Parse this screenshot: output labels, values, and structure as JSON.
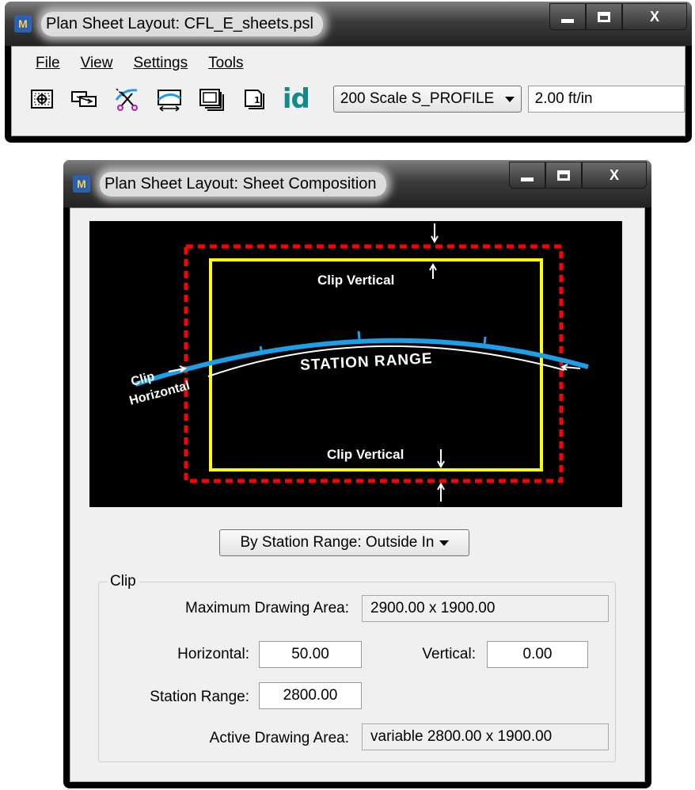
{
  "main_window": {
    "title": "Plan Sheet Layout: CFL_E_sheets.psl",
    "app_icon_glyph": "M",
    "menu": [
      {
        "label": "File"
      },
      {
        "label": "View"
      },
      {
        "label": "Settings"
      },
      {
        "label": "Tools"
      }
    ],
    "toolbar": {
      "tools": [
        {
          "icon": "place-sheet-icon"
        },
        {
          "icon": "move-sheet-icon"
        },
        {
          "icon": "clip-sheet-icon"
        },
        {
          "icon": "sheet-along-alignment-icon"
        },
        {
          "icon": "sheet-composition-icon"
        },
        {
          "icon": "sheet-number-icon"
        }
      ],
      "id_label": "id",
      "scale_selected": "200 Scale S_PROFILE",
      "ratio_value": "2.00 ft/in"
    },
    "caption_close": "X"
  },
  "composition_window": {
    "title": "Plan Sheet Layout: Sheet Composition",
    "app_icon_glyph": "M",
    "caption_close": "X",
    "preview": {
      "clip_vertical_top": "Clip Vertical",
      "clip_vertical_bottom": "Clip Vertical",
      "station_range": "STATION RANGE",
      "clip_horizontal_1": "Clip",
      "clip_horizontal_2": "Horizontal",
      "colors": {
        "background": "#000000",
        "outer_border": "#ff0000",
        "inner_border": "#ffff00",
        "alignment": "#1f9ee8",
        "annotation": "#ffffff"
      }
    },
    "clip_mode_selected": "By Station Range: Outside In",
    "clip_group": {
      "label": "Clip",
      "max_area_label": "Maximum Drawing Area:",
      "max_area_value": "2900.00 x  1900.00",
      "horizontal_label": "Horizontal:",
      "horizontal_value": "50.00",
      "vertical_label": "Vertical:",
      "vertical_value": "0.00",
      "station_range_label": "Station Range:",
      "station_range_value": "2800.00",
      "active_area_label": "Active Drawing Area:",
      "active_area_value": "variable  2800.00 x  1900.00"
    }
  }
}
